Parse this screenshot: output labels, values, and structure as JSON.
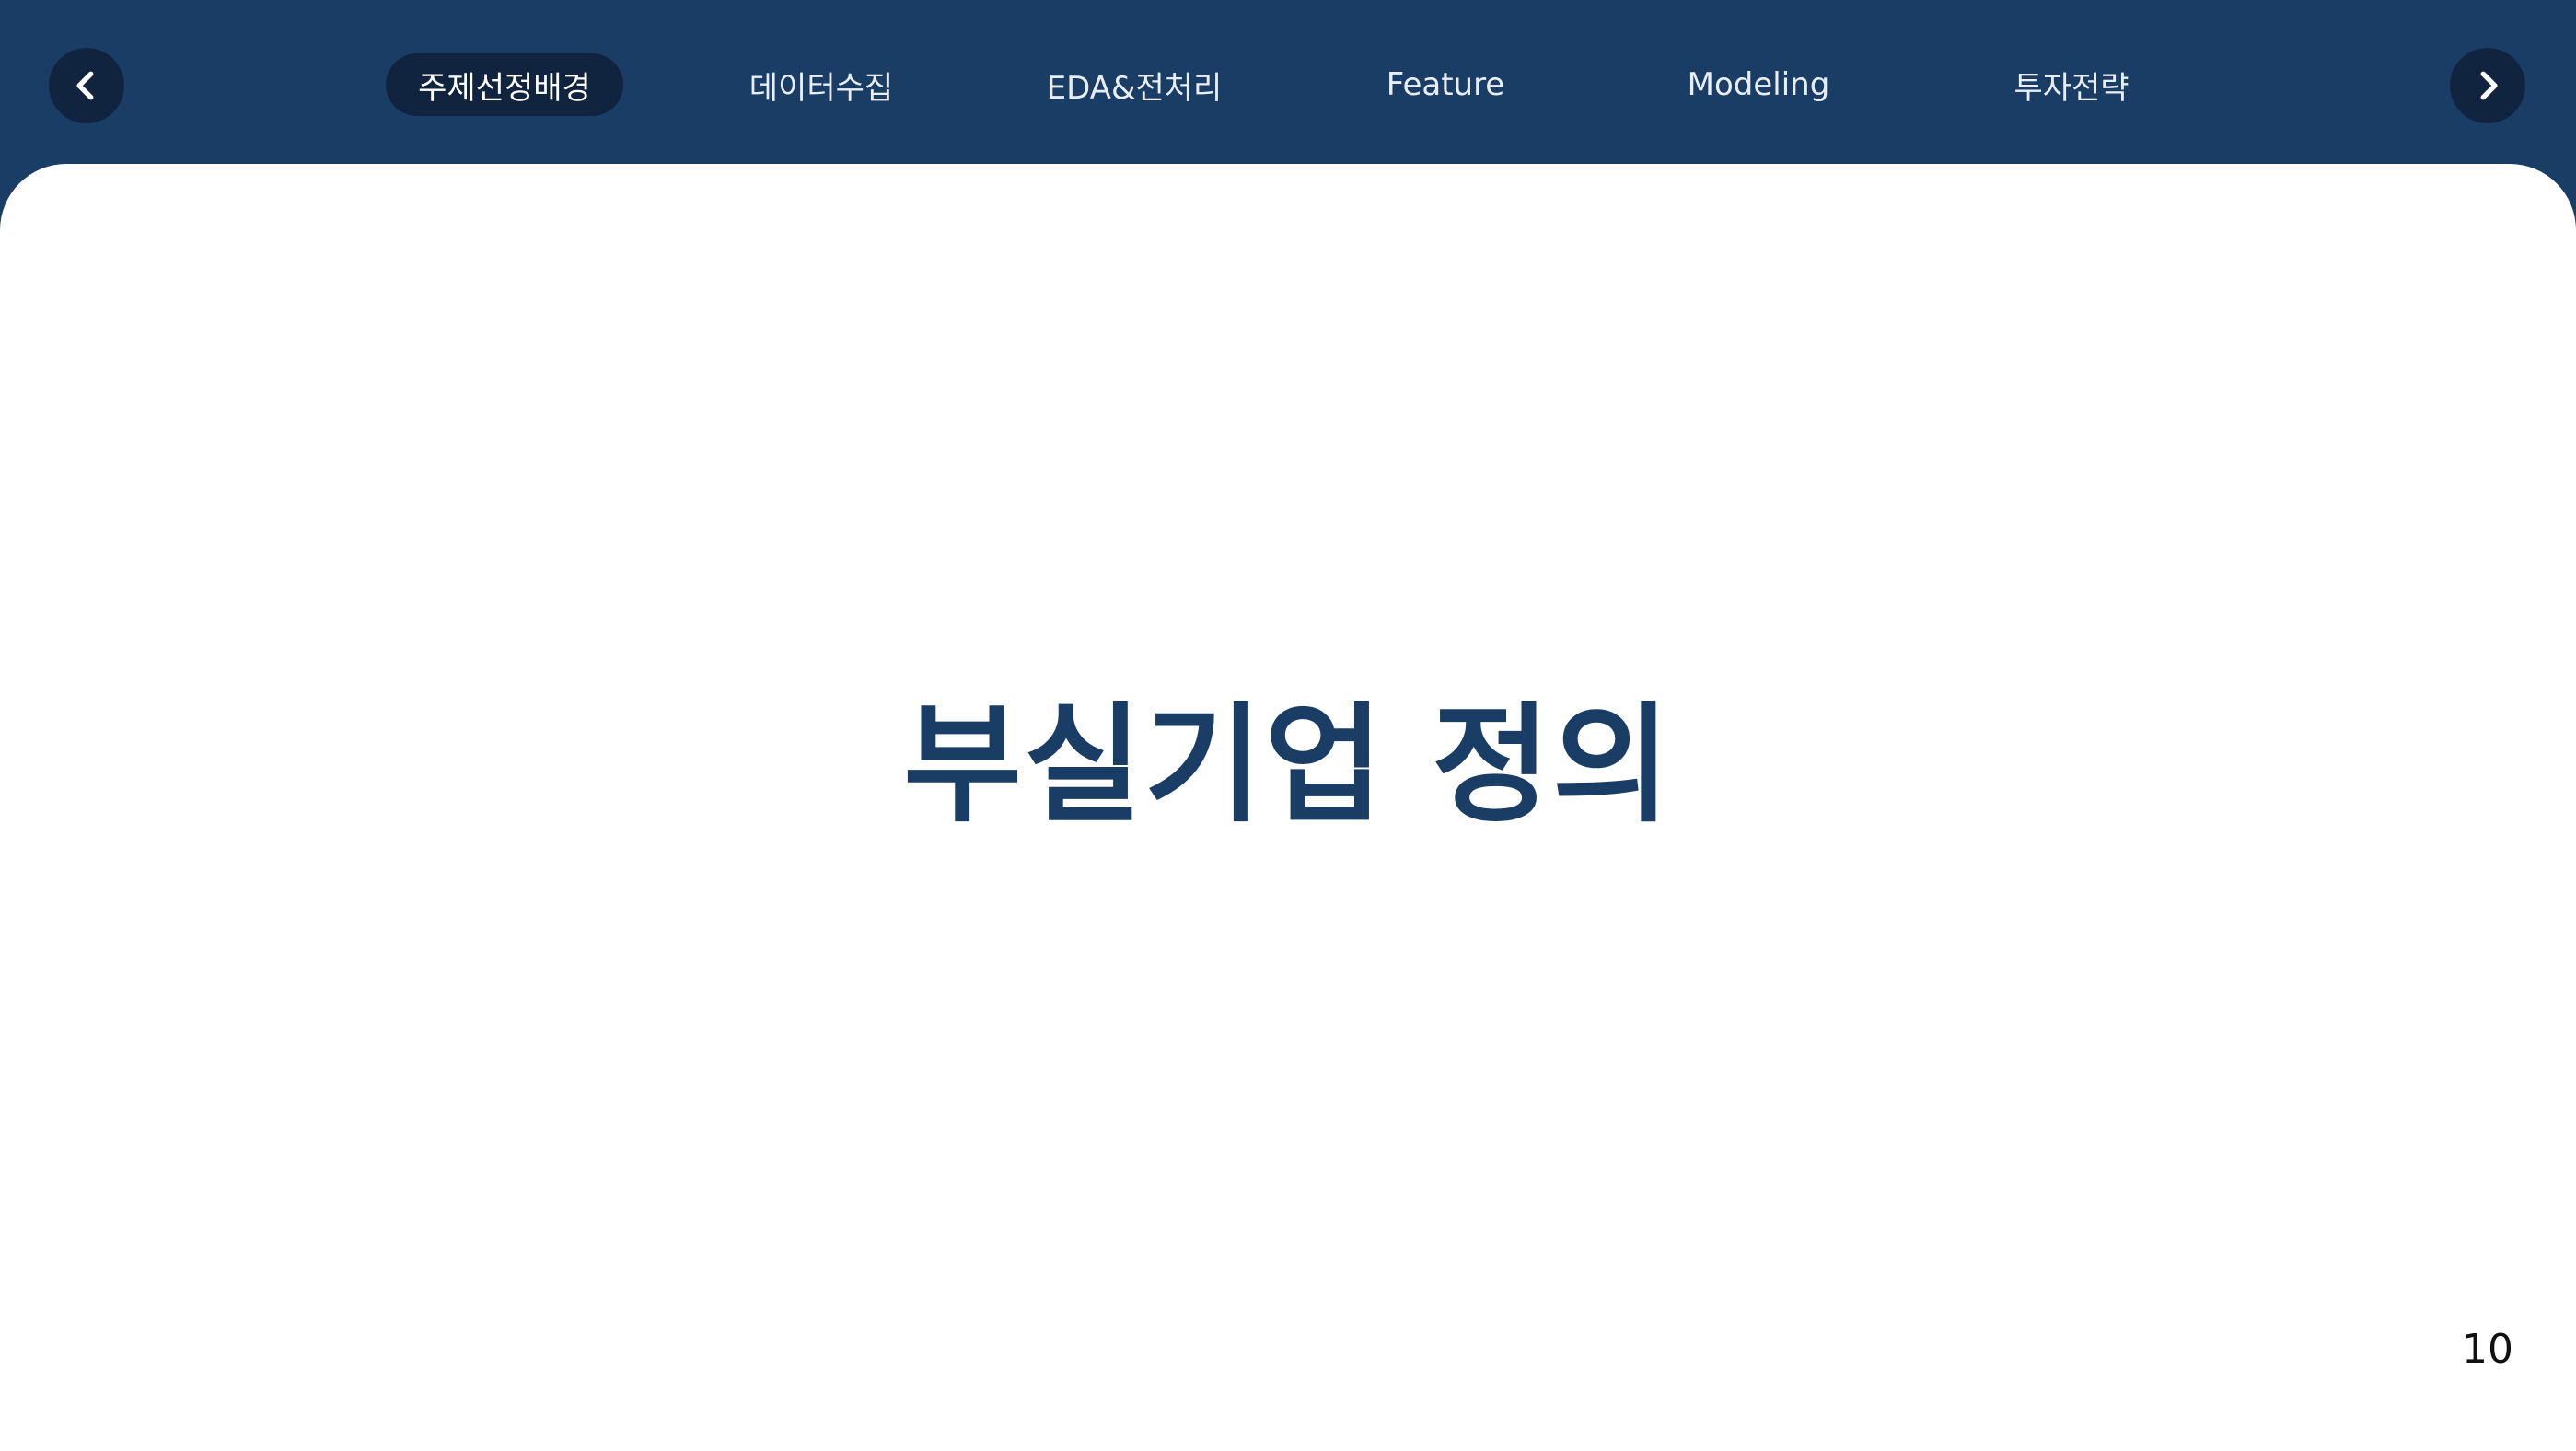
{
  "header": {
    "prev_button_icon": "chevron-left-icon",
    "next_button_icon": "chevron-right-icon",
    "tabs": [
      {
        "label": "주제선정배경",
        "active": true
      },
      {
        "label": "데이터수집",
        "active": false
      },
      {
        "label": "EDA&전처리",
        "active": false
      },
      {
        "label": "Feature",
        "active": false
      },
      {
        "label": "Modeling",
        "active": false
      },
      {
        "label": "투자전략",
        "active": false
      }
    ]
  },
  "slide": {
    "title": "부실기업 정의",
    "page_number": "10"
  },
  "colors": {
    "header_background": "#1a3d66",
    "active_tab_background": "#11243f",
    "title_color": "#1a3d66",
    "content_background": "#ffffff"
  }
}
